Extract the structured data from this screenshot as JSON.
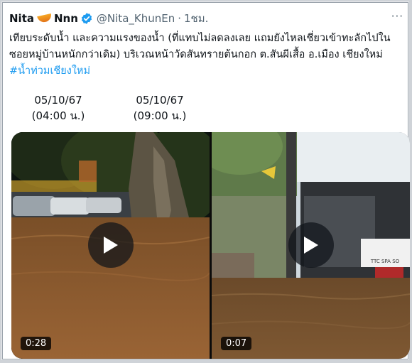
{
  "author": {
    "display_name": "Nita",
    "display_name_suffix": "Nnn",
    "handle": "@Nita_KhunEn",
    "separator": "·",
    "time_ago": "1ชม.",
    "more_label": "···"
  },
  "tweet": {
    "text": "เทียบระดับน้ำ และความแรงของน้ำ (ที่แทบไม่ลดลงเลย แถมยังไหลเชี่ยวเข้าทะลักไปในซอยหมู่บ้านหนักกว่าเดิม) บริเวณหน้าวัดสันทรายต้นกอก ต.สันผีเสื้อ อ.เมือง เชียงใหม่",
    "hashtag": "#น้ำท่วมเชียงใหม่",
    "times": [
      {
        "date": "05/10/67",
        "time": "(04:00 น.)"
      },
      {
        "date": "05/10/67",
        "time": "(09:00 น.)"
      }
    ]
  },
  "videos": [
    {
      "duration": "0:28"
    },
    {
      "duration": "0:07"
    }
  ],
  "video2_sign_text": "TTC SPA SO",
  "colors": {
    "verified": "#1d9bf0",
    "hashtag": "#1d9bf0",
    "handle": "#536471",
    "text": "#0f1419",
    "flood_water": "#8a5a2b"
  }
}
